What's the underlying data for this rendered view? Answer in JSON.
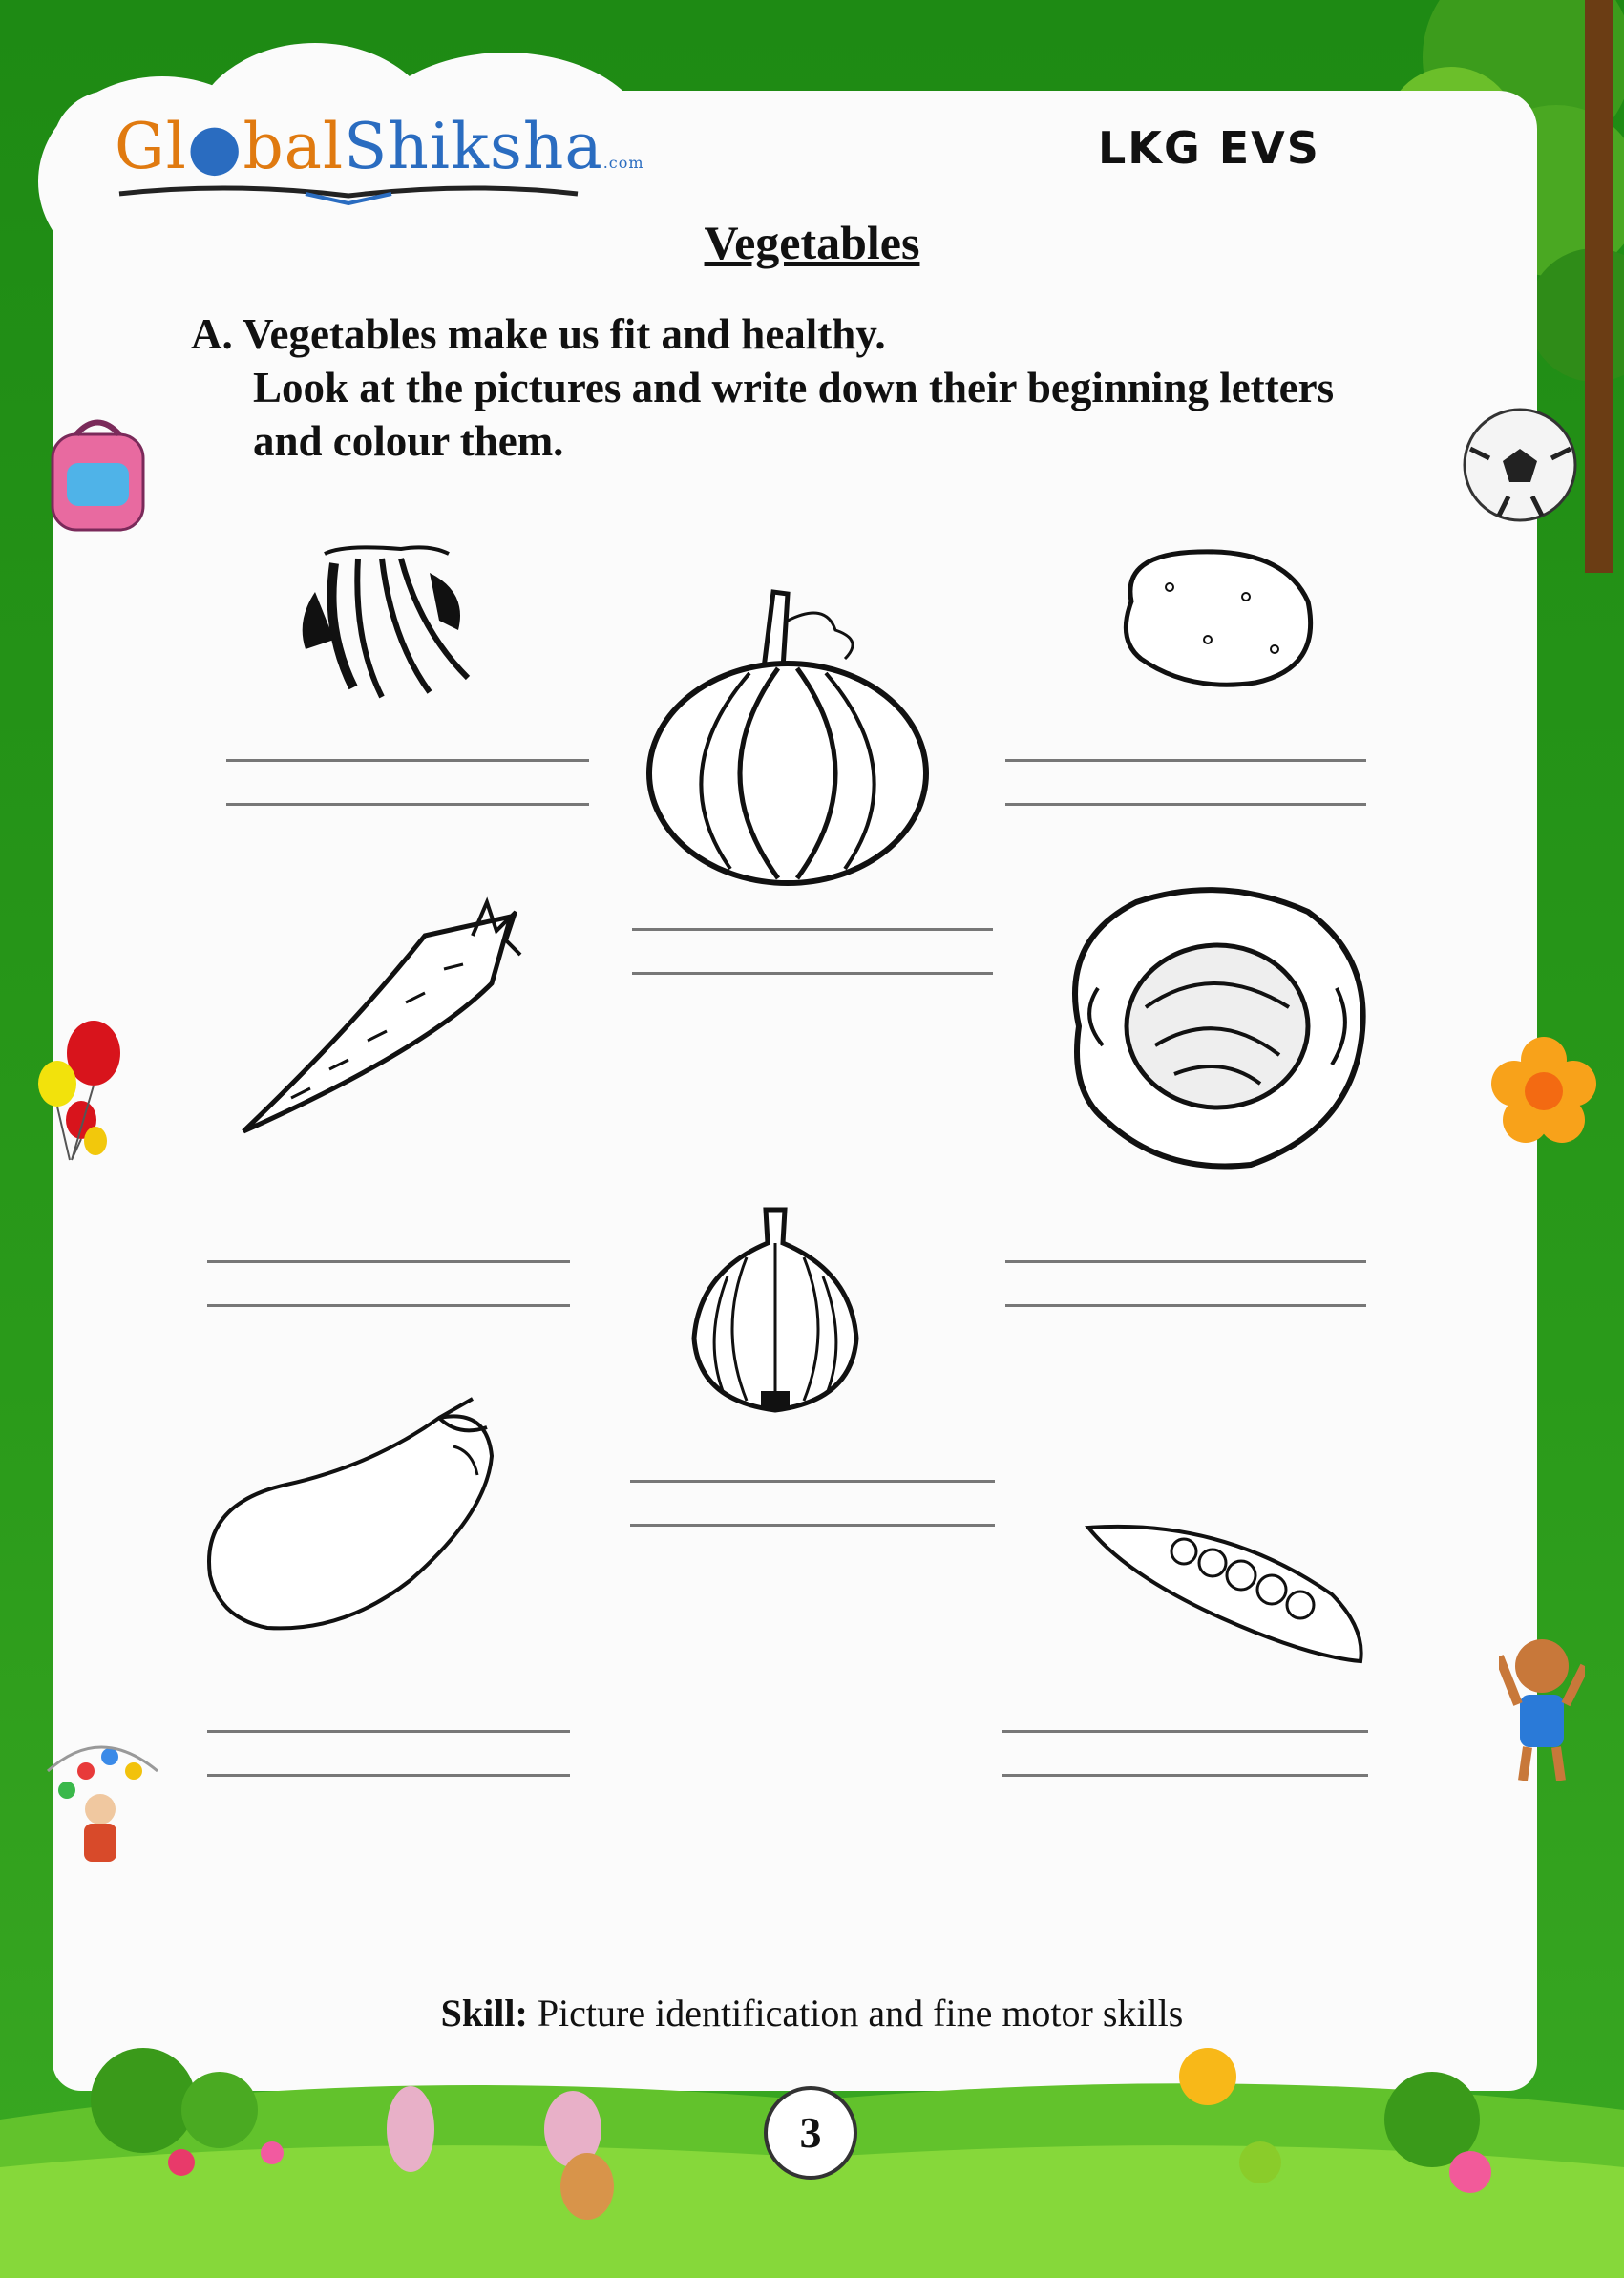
{
  "header": {
    "logo_text_1": "Gl",
    "logo_text_2": "bal",
    "logo_text_3": "Shiksha",
    "logo_com": ".com",
    "subject": "LKG EVS"
  },
  "worksheet": {
    "title": "Vegetables",
    "instruction_line1": "A. Vegetables make us fit and healthy.",
    "instruction_line2": "Look at the pictures and write down their beginning letters",
    "instruction_line3": "and colour them."
  },
  "footer": {
    "skill_label": "Skill:",
    "skill_text": "Picture identification and fine motor skills",
    "page_number": "3"
  },
  "colors": {
    "border_green": "#1e8a14",
    "sheet": "#fbfbfb",
    "logo_orange": "#e07a10",
    "logo_blue": "#2a6cc0"
  },
  "vegetables": [
    "beans",
    "pumpkin",
    "potato",
    "carrot",
    "cabbage",
    "onion",
    "brinjal",
    "peas"
  ]
}
